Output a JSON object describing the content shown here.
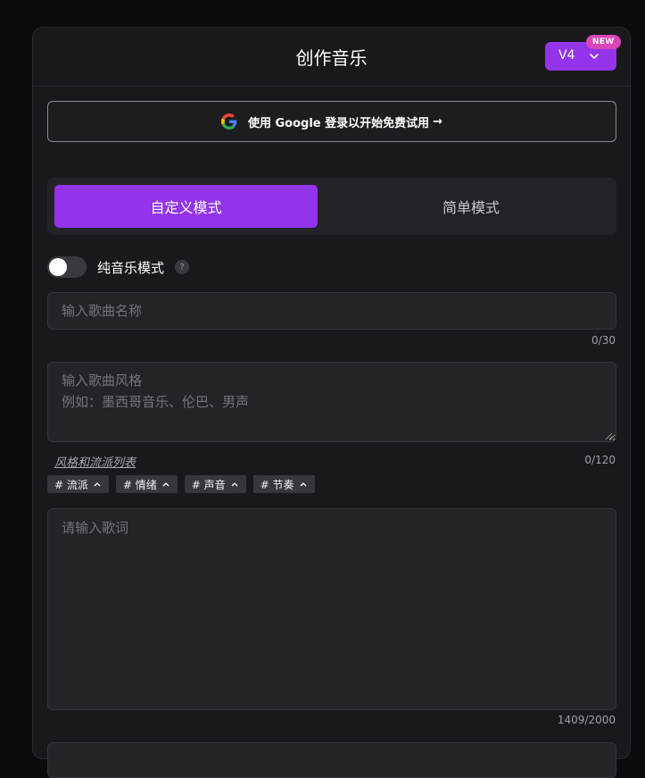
{
  "header": {
    "title": "创作音乐",
    "version_label": "V4",
    "new_badge": "NEW"
  },
  "google_login": {
    "label": "使用 Google 登录以开始免费试用",
    "arrow": "→"
  },
  "mode_tabs": [
    {
      "label": "自定义模式",
      "active": true
    },
    {
      "label": "简单模式",
      "active": false
    }
  ],
  "instrumental": {
    "label": "纯音乐模式",
    "help": "?",
    "enabled": false
  },
  "song_title": {
    "placeholder": "输入歌曲名称",
    "value": "",
    "counter": "0/30"
  },
  "song_style": {
    "placeholder": "输入歌曲风格\n例如：墨西哥音乐、伦巴、男声",
    "value": "",
    "counter": "0/120",
    "genre_link": "风格和流派列表"
  },
  "tags": [
    {
      "label": "# 流派"
    },
    {
      "label": "# 情绪"
    },
    {
      "label": "# 声音"
    },
    {
      "label": "# 节奏"
    }
  ],
  "lyrics": {
    "placeholder": "请输入歌词",
    "value": "",
    "counter": "1409/2000"
  },
  "colors": {
    "accent": "#9333ea",
    "badge": "#d946b8",
    "panel": "#19181d",
    "background": "#0b0b0e"
  },
  "icons": {
    "google": "google-g-logo-icon",
    "version_chevron": "chevron-down-icon",
    "tag_chevron": "chevron-up-icon",
    "help": "question-icon",
    "resize": "resize-grip-icon"
  }
}
